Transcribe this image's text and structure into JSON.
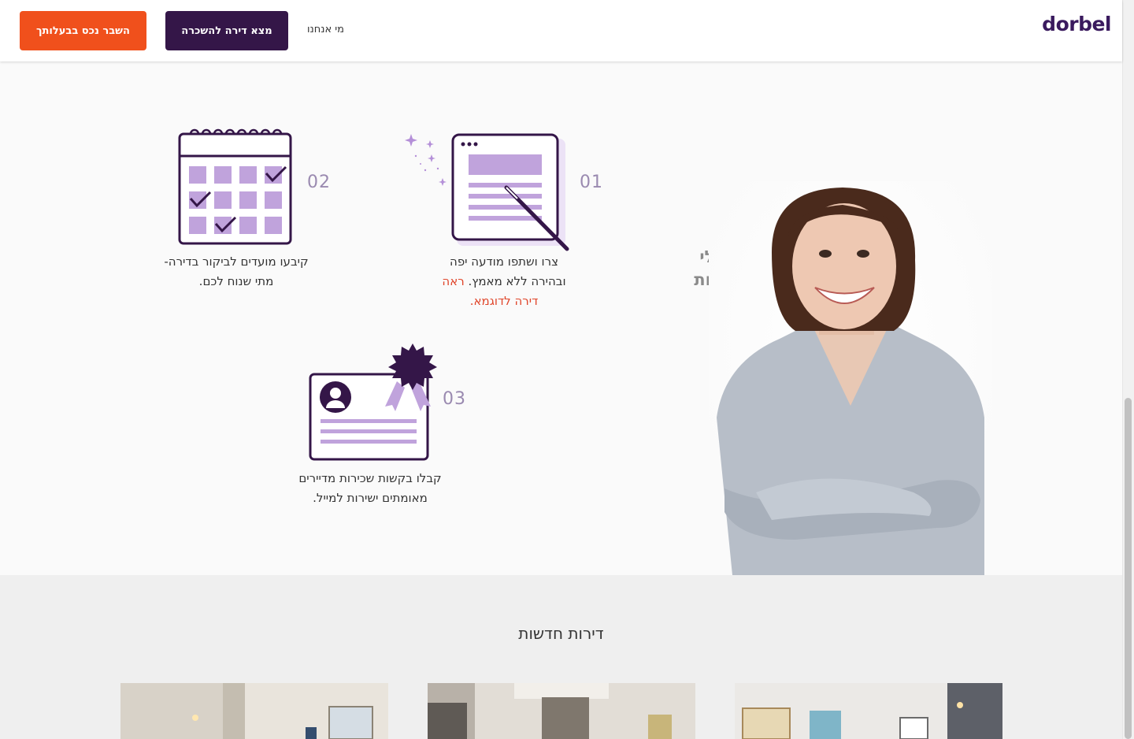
{
  "header": {
    "logo": "dorbel",
    "list_property_label": "השבר נכס בבעלותך",
    "find_apartment_label": "מצא דירה להשכרה",
    "about_label": "מי אנחנו"
  },
  "owners": {
    "title": "בעלי דירות",
    "steps": [
      {
        "num": "01",
        "text_main": "צרו ושתפו מודעה יפה ובהירה ללא מאמץ.",
        "link_text": "ראה דירה לדוגמא."
      },
      {
        "num": "02",
        "text_main": "קיבעו מועדים לביקור בדירה- מתי שנוח לכם."
      },
      {
        "num": "03",
        "text_main": "קבלו בקשות שכירות מדיירים מאומתים ישירות למייל."
      }
    ]
  },
  "new_apartments": {
    "title": "דירות חדשות"
  },
  "colors": {
    "accent_orange": "#f0501c",
    "brand_purple": "#341648",
    "icon_purple": "#c0a3dc",
    "link_red": "#e0462b"
  },
  "icons": [
    "listing-magic-wand-icon",
    "calendar-icon",
    "certificate-badge-icon"
  ]
}
